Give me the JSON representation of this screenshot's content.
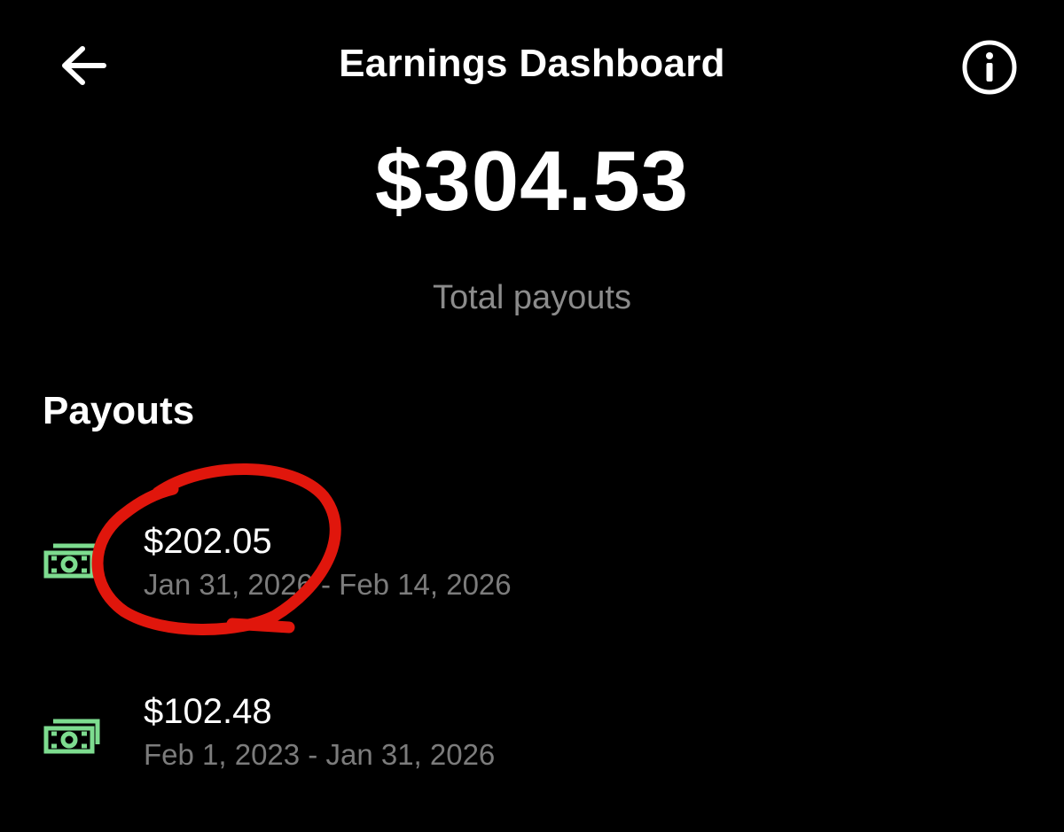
{
  "header": {
    "title": "Earnings Dashboard",
    "back_icon": "arrow-left-icon",
    "info_icon": "info-circle-icon"
  },
  "summary": {
    "total": "$304.53",
    "label": "Total payouts"
  },
  "payouts": {
    "heading": "Payouts",
    "items": [
      {
        "amount": "$202.05",
        "range": "Jan 31, 2026 - Feb 14, 2026",
        "icon": "money-stack-icon"
      },
      {
        "amount": "$102.48",
        "range": "Feb 1, 2023 - Jan 31, 2026",
        "icon": "money-stack-icon"
      }
    ]
  },
  "colors": {
    "background": "#000000",
    "text_primary": "#ffffff",
    "text_secondary": "#7c7c7c",
    "money_icon": "#7ddc8f",
    "annotation": "#e0160c"
  }
}
